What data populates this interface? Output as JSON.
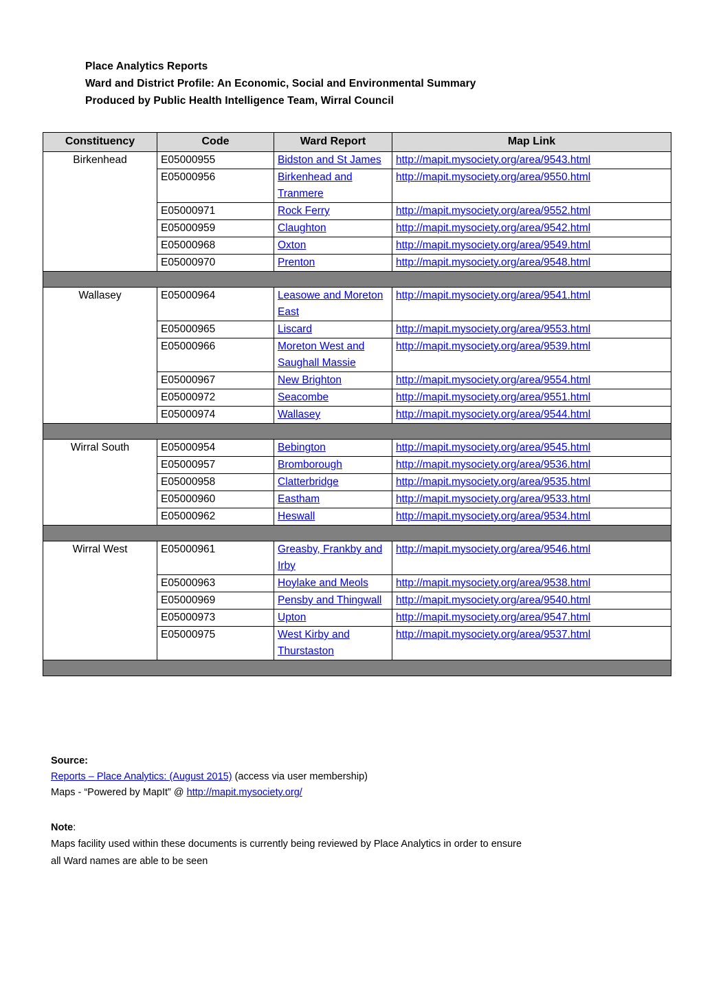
{
  "document": {
    "heading_lines": [
      "Place Analytics Reports",
      "Ward and District Profile: An Economic, Social and Environmental Summary",
      "Produced by Public Health Intelligence Team, Wirral Council"
    ]
  },
  "table": {
    "columns": [
      "Constituency",
      "Code",
      "Ward Report",
      "Map Link"
    ],
    "groups": [
      {
        "constituency": "Birkenhead",
        "rows": [
          {
            "code": "E05000955",
            "ward": "Bidston and St James",
            "map_link": "http://mapit.mysociety.org/area/9543.html"
          },
          {
            "code": "E05000956",
            "ward": "Birkenhead and Tranmere",
            "map_link": "http://mapit.mysociety.org/area/9550.html"
          },
          {
            "code": "E05000971",
            "ward": "Rock Ferry",
            "map_link": "http://mapit.mysociety.org/area/9552.html"
          },
          {
            "code": "E05000959",
            "ward": "Claughton",
            "map_link": "http://mapit.mysociety.org/area/9542.html"
          },
          {
            "code": "E05000968",
            "ward": "Oxton",
            "map_link": "http://mapit.mysociety.org/area/9549.html"
          },
          {
            "code": "E05000970",
            "ward": "Prenton",
            "map_link": "http://mapit.mysociety.org/area/9548.html"
          }
        ]
      },
      {
        "constituency": "Wallasey",
        "rows": [
          {
            "code": "E05000964",
            "ward": "Leasowe and Moreton East",
            "map_link": "http://mapit.mysociety.org/area/9541.html"
          },
          {
            "code": "E05000965",
            "ward": "Liscard",
            "map_link": "http://mapit.mysociety.org/area/9553.html"
          },
          {
            "code": "E05000966",
            "ward": "Moreton West and Saughall Massie",
            "map_link": "http://mapit.mysociety.org/area/9539.html"
          },
          {
            "code": "E05000967",
            "ward": "New Brighton",
            "map_link": "http://mapit.mysociety.org/area/9554.html"
          },
          {
            "code": "E05000972",
            "ward": "Seacombe",
            "map_link": "http://mapit.mysociety.org/area/9551.html"
          },
          {
            "code": "E05000974",
            "ward": "Wallasey",
            "map_link": "http://mapit.mysociety.org/area/9544.html"
          }
        ]
      },
      {
        "constituency": "Wirral South",
        "rows": [
          {
            "code": "E05000954",
            "ward": "Bebington",
            "map_link": "http://mapit.mysociety.org/area/9545.html"
          },
          {
            "code": "E05000957",
            "ward": "Bromborough",
            "map_link": "http://mapit.mysociety.org/area/9536.html"
          },
          {
            "code": "E05000958",
            "ward": "Clatterbridge",
            "map_link": "http://mapit.mysociety.org/area/9535.html"
          },
          {
            "code": "E05000960",
            "ward": "Eastham",
            "map_link": "http://mapit.mysociety.org/area/9533.html"
          },
          {
            "code": "E05000962",
            "ward": "Heswall",
            "map_link": "http://mapit.mysociety.org/area/9534.html"
          }
        ]
      },
      {
        "constituency": "Wirral West",
        "rows": [
          {
            "code": "E05000961",
            "ward": "Greasby, Frankby and Irby",
            "map_link": "http://mapit.mysociety.org/area/9546.html"
          },
          {
            "code": "E05000963",
            "ward": "Hoylake and Meols",
            "map_link": "http://mapit.mysociety.org/area/9538.html"
          },
          {
            "code": "E05000969",
            "ward": "Pensby and Thingwall",
            "map_link": "http://mapit.mysociety.org/area/9540.html"
          },
          {
            "code": "E05000973",
            "ward": "Upton",
            "map_link": "http://mapit.mysociety.org/area/9547.html"
          },
          {
            "code": "E05000975",
            "ward": "West Kirby and Thurstaston",
            "map_link": "http://mapit.mysociety.org/area/9537.html"
          }
        ]
      }
    ]
  },
  "footer": {
    "source_label": "Source:",
    "source_link_text": "Reports – Place Analytics:  (August 2015)",
    "source_link_suffix": "  (access via user membership)",
    "maps_prefix": "Maps - “Powered by MapIt” @ ",
    "maps_link_text": "http://mapit.mysociety.org/",
    "note_label": "Note",
    "note_label_colon": ":",
    "note_line1": "Maps facility used within these documents is currently being reviewed by Place Analytics in order to ensure",
    "note_line2": "all Ward names are able to be seen"
  },
  "colors": {
    "link": "#0000ee",
    "header_fill": "#d9d9d9",
    "separator_fill": "#808080",
    "text": "#000000"
  }
}
